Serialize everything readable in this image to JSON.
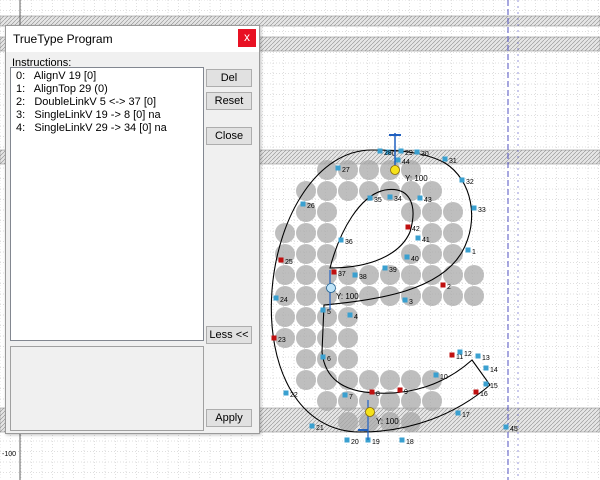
{
  "dialog": {
    "title": "TrueType Program",
    "close_glyph": "x",
    "instructions_label": "Instructions:",
    "instructions": [
      {
        "index": "0:",
        "text": "AlignV 19 [0]"
      },
      {
        "index": "1:",
        "text": "AlignTop 29 (0)"
      },
      {
        "index": "2:",
        "text": "DoubleLinkV 5 <-> 37 [0]"
      },
      {
        "index": "3:",
        "text": "SingleLinkV 19 -> 8 [0] na"
      },
      {
        "index": "4:",
        "text": "SingleLinkV 29 -> 34 [0] na"
      }
    ],
    "buttons": {
      "del": "Del",
      "reset": "Reset",
      "close": "Close",
      "less": "Less <<",
      "apply": "Apply"
    }
  },
  "ruler": {
    "tick_label": "-100"
  },
  "glyph": {
    "y_labels": [
      "Y: 100",
      "Y: 100",
      "Y: 100"
    ],
    "point_labels": [
      "0",
      "1",
      "2",
      "3",
      "4",
      "5",
      "6",
      "7",
      "8",
      "9",
      "10",
      "11",
      "12",
      "13",
      "14",
      "15",
      "16",
      "17",
      "18",
      "19",
      "20",
      "21",
      "22",
      "23",
      "24",
      "25",
      "26",
      "27",
      "28",
      "29",
      "30",
      "31",
      "32",
      "33",
      "34",
      "35",
      "36",
      "37",
      "38",
      "39",
      "40",
      "41",
      "42",
      "43",
      "44",
      "45"
    ],
    "marker_labels": {
      "round": "R"
    }
  },
  "colors": {
    "grid": "#bfbfbf",
    "band": "#e0e0e0",
    "outline": "#000000",
    "pixel": "#a8a8a8",
    "hint_marker": "#f5e21a",
    "handle_blue": "#2060c0"
  }
}
